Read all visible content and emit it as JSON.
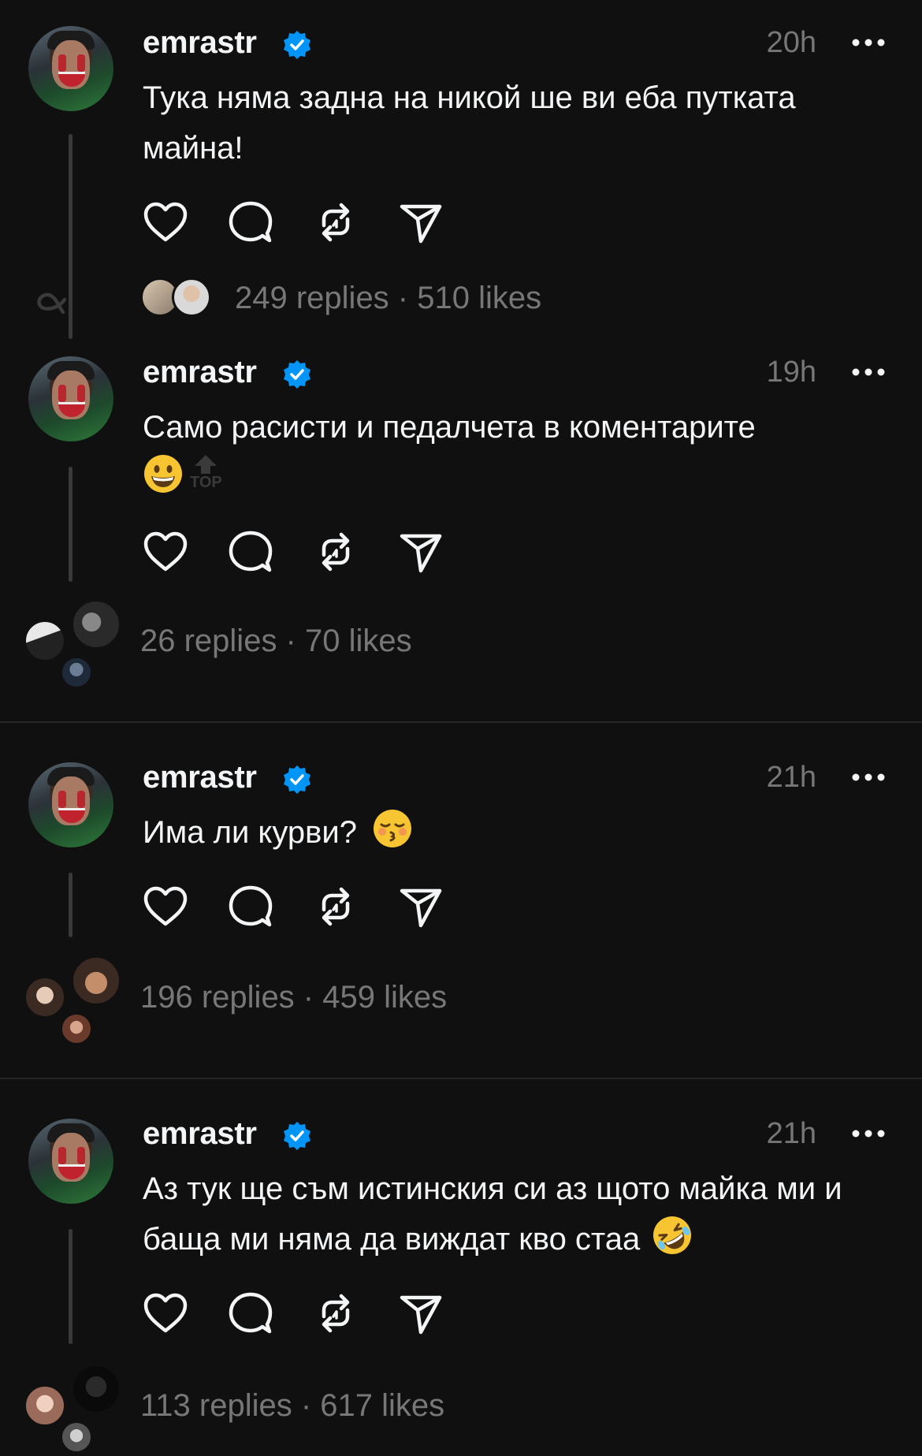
{
  "posts": [
    {
      "username": "emrastr",
      "time": "20h",
      "text": "Тука няма задна на никой ше ви еба путката майна!",
      "stats": "249 replies · 510 likes"
    },
    {
      "username": "emrastr",
      "time": "19h",
      "text": "Само расисти и педалчета в коментарите",
      "emoji": "grinning-face",
      "badge": "TOP",
      "stats": "26 replies · 70 likes"
    },
    {
      "username": "emrastr",
      "time": "21h",
      "text": "Има ли курви?",
      "emoji": "kissing-face-closed-eyes",
      "stats": "196 replies · 459 likes"
    },
    {
      "username": "emrastr",
      "time": "21h",
      "text": "Аз тук ще съм истинския си аз щото майка ми и баща ми няма да виждат кво стаа",
      "emoji": "rolling-on-floor-laughing",
      "stats": "113 replies · 617 likes"
    }
  ],
  "icons": {
    "like": "heart-icon",
    "reply": "comment-bubble-icon",
    "repost": "repost-icon",
    "share": "send-icon",
    "more": "more-dots-icon",
    "verified": "verified-badge-icon"
  },
  "colors": {
    "background": "#101010",
    "text": "#f3f5f7",
    "muted": "#777777",
    "verified": "#0095f6"
  }
}
